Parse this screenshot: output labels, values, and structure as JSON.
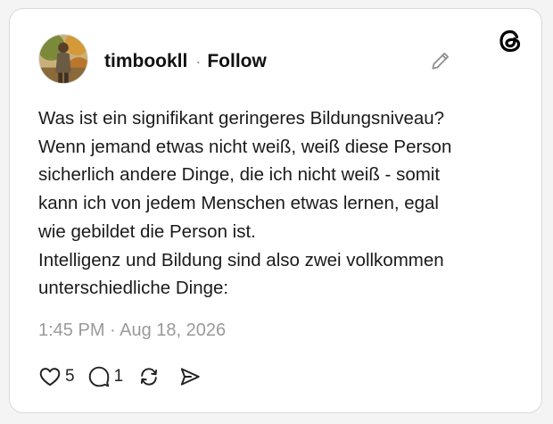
{
  "post": {
    "username": "timbookll",
    "separator": "·",
    "follow_label": "Follow",
    "text_lines": [
      "Was ist ein signifikant geringeres Bildungsniveau?",
      "Wenn jemand etwas nicht weiß, weiß diese Person",
      "sicherlich andere Dinge, die ich nicht weiß - somit",
      "kann ich von jedem Menschen etwas lernen, egal",
      "wie gebildet die Person ist.",
      "Intelligenz und Bildung sind also zwei vollkommen",
      "unterschiedliche Dinge:"
    ],
    "timestamp": "1:45 PM · Aug 18, 2026",
    "like_count": "5",
    "reply_count": "1"
  },
  "icons": {
    "edit": "pencil-icon",
    "brand": "threads-logo-icon",
    "like": "heart-icon",
    "reply": "comment-icon",
    "repost": "repost-icon",
    "share": "send-icon"
  },
  "colors": {
    "text": "#111111",
    "muted": "#9a9a9a",
    "card_border": "#d9d9d9",
    "background": "#f4f4f4"
  }
}
